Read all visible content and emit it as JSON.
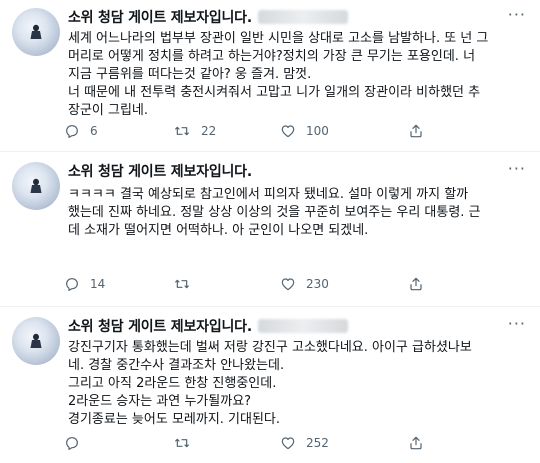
{
  "tweets": [
    {
      "display_name": "소위 청담 게이트 제보자입니다.",
      "lines": [
        "세계 어느나라의 법부부 장관이 일반 시민을 상대로 고소를 남발하나. 또 넌 그",
        "머리로 어떻게 정치를 하려고 하는거야?정치의 가장 큰 무기는 포용인데. 너",
        "지금 구름위를 떠다는것 같아? 웅 즐겨. 맘껏.",
        "너 때문에 내 전투력 충전시켜줘서 고맙고 니가 일개의 장관이라 비하했던 추",
        "장군이 그립네."
      ],
      "replies": "6",
      "retweets": "22",
      "likes": "100"
    },
    {
      "display_name": "소위 청담 게이트 제보자입니다.",
      "lines": [
        "ㅋㅋㅋㅋ 결국 예상되로 참고인에서 피의자 됐네요. 설마 이렇게 까지 할까",
        "했는데 진짜 하네요. 정말 상상 이상의 것을 꾸준히 보여주는 우리 대통령. 근",
        "데 소재가 떨어지면 어떡하나. 아 군인이 나오면 되겠네."
      ],
      "replies": "14",
      "retweets": "",
      "likes": "230"
    },
    {
      "display_name": "소위 청담 게이트 제보자입니다.",
      "lines": [
        "강진구기자 통화했는데 벌써 저랑 강진구  고소했다네요. 아이구 급하셨나보",
        "네. 경찰 중간수사 결과조차 안나왔는데.",
        "그리고 아직 2라운드 한창 진행중인데.",
        "2라운드 승자는 과연 누가될까요?",
        "경기종료는 늦어도 모레까지. 기대된다."
      ],
      "replies": "",
      "retweets": "",
      "likes": "252"
    }
  ],
  "icons": {
    "more": "more-horizontal-icon",
    "reply": "reply-icon",
    "retweet": "retweet-icon",
    "like": "heart-icon",
    "share": "share-icon"
  },
  "colors": {
    "text": "#0f1419",
    "muted": "#536471",
    "divider": "#eff3f4"
  }
}
